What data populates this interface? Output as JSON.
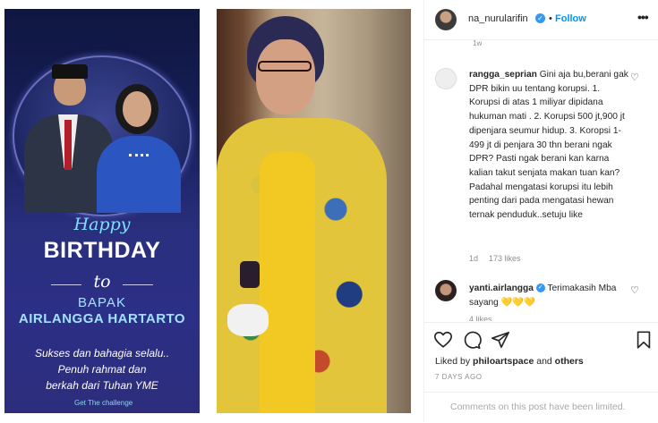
{
  "post": {
    "image1": {
      "happy": "Happy",
      "birthday": "BIRTHDAY",
      "to": "to",
      "bapak": "BAPAK",
      "name": "AIRLANGGA HARTARTO",
      "wish_lines": [
        "Sukses dan bahagia selalu..",
        "Penuh rahmat dan",
        "berkah dari Tuhan YME"
      ],
      "footer": "Get The challenge"
    }
  },
  "header": {
    "username": "na_nurularifin",
    "verified_mark": "✓",
    "separator": "•",
    "follow_label": "Follow",
    "more_label": "•••",
    "clipped_time": "1w"
  },
  "comments": [
    {
      "username": "rangga_seprian",
      "text": "Gini aja bu,berani gak DPR bikin uu tentang korupsi. 1. Korupsi di atas 1 miliyar dipidana hukuman mati . 2. Korupsi 500 jt,900 jt dipenjara seumur hidup. 3. Koropsi 1-499 jt di penjara 30 thn berani ngak DPR? Pasti ngak berani kan karna kalian takut senjata makan tuan kan? Padahal mengatasi korupsi itu lebih penting dari pada mengatasi hewan ternak penduduk..setuju like",
      "age": "1d",
      "likes": "173 likes"
    },
    {
      "username": "yanti.airlangga",
      "verified_mark": "✓",
      "text": "Terimakasih Mba sayang",
      "emoji": "💛💛💛",
      "clipped_likes": "4 likes"
    }
  ],
  "footer": {
    "liked_prefix": "Liked by ",
    "liked_user": "philoartspace",
    "liked_and": " and ",
    "liked_others": "others",
    "timestamp": "7 DAYS AGO",
    "limited": "Comments on this post have been limited."
  }
}
